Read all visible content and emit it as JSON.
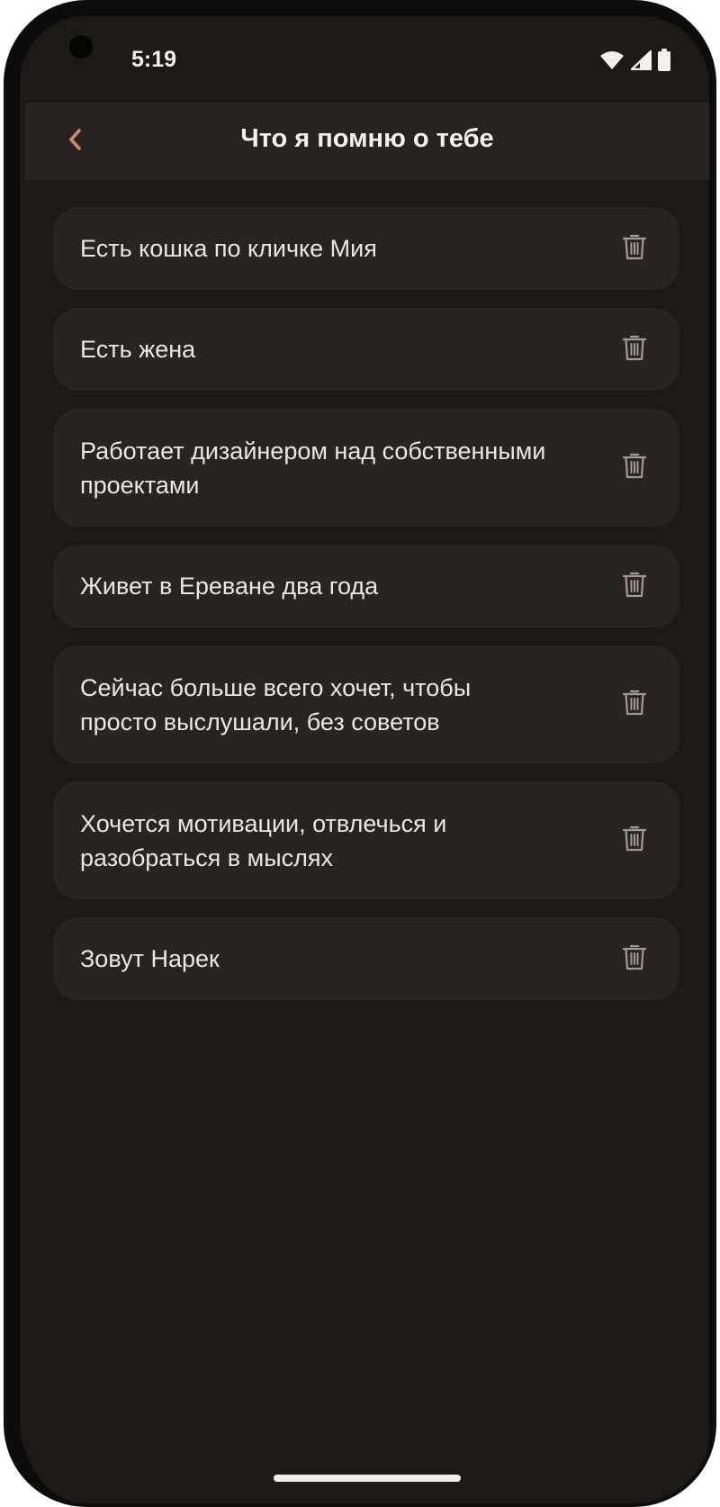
{
  "status_bar": {
    "time": "5:19",
    "icons": [
      "wifi-icon",
      "signal-icon",
      "battery-icon"
    ]
  },
  "app_bar": {
    "back_icon": "chevron-left-icon",
    "title": "Что я помню о тебе"
  },
  "memories": [
    {
      "text": "Есть кошка по кличке Мия",
      "icon": "trash-icon"
    },
    {
      "text": "Есть жена",
      "icon": "trash-icon"
    },
    {
      "text": "Работает дизайнером над собственными проектами",
      "icon": "trash-icon"
    },
    {
      "text": "Живет в Ереване два года",
      "icon": "trash-icon"
    },
    {
      "text": "Сейчас больше всего хочет, чтобы просто выслушали, без советов",
      "icon": "trash-icon"
    },
    {
      "text": "Хочется мотивации, отвлечься и разобраться в мыслях",
      "icon": "trash-icon"
    },
    {
      "text": "Зовут Нарек",
      "icon": "trash-icon"
    }
  ],
  "colors": {
    "background": "#1c1917",
    "app_bar": "#282321",
    "card": "#292421",
    "text": "#ece7e2",
    "accent_back": "#d0886a",
    "trash_icon": "#a39a94"
  }
}
